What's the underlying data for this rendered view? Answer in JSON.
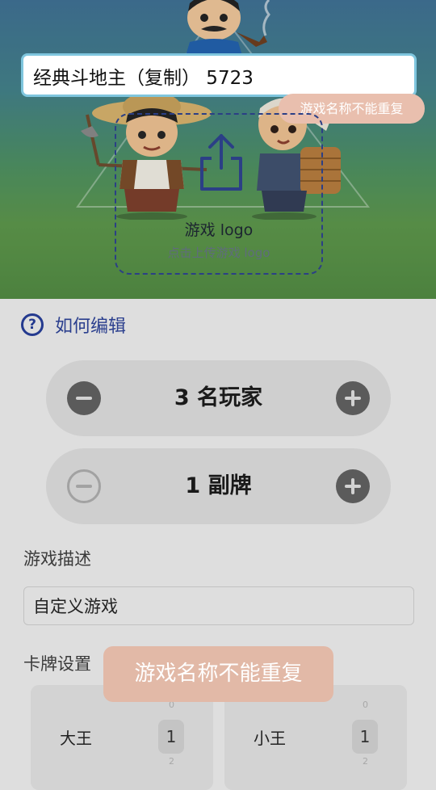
{
  "game_name": {
    "value": "经典斗地主（复制） 5723"
  },
  "name_error_tip": "游戏名称不能重复",
  "logo_upload": {
    "title": "游戏 logo",
    "subtitle": "点击上传游戏 logo"
  },
  "help": {
    "label": "如何编辑"
  },
  "players_stepper": {
    "value": "3 名玩家"
  },
  "decks_stepper": {
    "value": "1 副牌"
  },
  "description": {
    "label": "游戏描述",
    "value": "自定义游戏"
  },
  "card_settings": {
    "label": "卡牌设置",
    "cards": [
      {
        "name": "大王",
        "count": "1",
        "above": "0",
        "below": "2"
      },
      {
        "name": "小王",
        "count": "1",
        "above": "0",
        "below": "2"
      }
    ]
  },
  "toast": "游戏名称不能重复",
  "colors": {
    "accent": "#243a8f",
    "toast": "#e2b9a7",
    "input_border": "#7fc6de"
  },
  "icons": [
    "upload-icon",
    "help-icon",
    "minus-icon",
    "plus-icon"
  ]
}
